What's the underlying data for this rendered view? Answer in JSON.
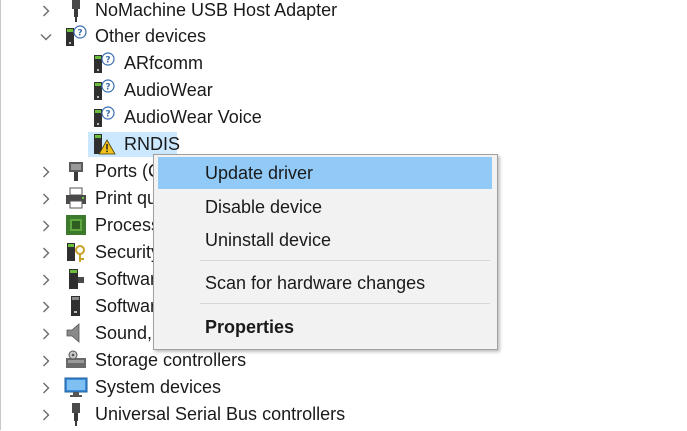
{
  "tree": {
    "items": [
      {
        "label": "NoMachine USB Host Adapter",
        "icon": "usb-plug-icon",
        "expander": "collapsed"
      },
      {
        "label": "Other devices",
        "icon": "unknown-device-icon",
        "expander": "expanded"
      },
      {
        "label": "ARfcomm",
        "icon": "unknown-device-icon"
      },
      {
        "label": "AudioWear",
        "icon": "unknown-device-icon"
      },
      {
        "label": "AudioWear Voice",
        "icon": "unknown-device-icon"
      },
      {
        "label": "RNDIS",
        "icon": "warning-device-icon",
        "selected": true
      },
      {
        "label": "Ports (C",
        "icon": "port-icon",
        "expander": "collapsed"
      },
      {
        "label": "Print qu",
        "icon": "printer-icon",
        "expander": "collapsed"
      },
      {
        "label": "Process",
        "icon": "processor-icon",
        "expander": "collapsed"
      },
      {
        "label": "Security",
        "icon": "security-device-icon",
        "expander": "collapsed"
      },
      {
        "label": "Softwar",
        "icon": "software-component-icon",
        "expander": "collapsed"
      },
      {
        "label": "Softwar",
        "icon": "software-device-icon",
        "expander": "collapsed"
      },
      {
        "label": "Sound,",
        "icon": "speaker-icon",
        "expander": "collapsed"
      },
      {
        "label": "Storage controllers",
        "icon": "storage-controller-icon",
        "expander": "collapsed"
      },
      {
        "label": "System devices",
        "icon": "system-devices-icon",
        "expander": "collapsed"
      },
      {
        "label": "Universal Serial Bus controllers",
        "icon": "usb-plug-icon",
        "expander": "collapsed"
      }
    ]
  },
  "context_menu": {
    "update_driver": "Update driver",
    "disable_device": "Disable device",
    "uninstall_device": "Uninstall device",
    "scan_hardware": "Scan for hardware changes",
    "properties": "Properties"
  },
  "colors": {
    "selection": "#cce8ff",
    "menu_highlight": "#91c9f7",
    "menu_background": "#f2f2f2"
  }
}
